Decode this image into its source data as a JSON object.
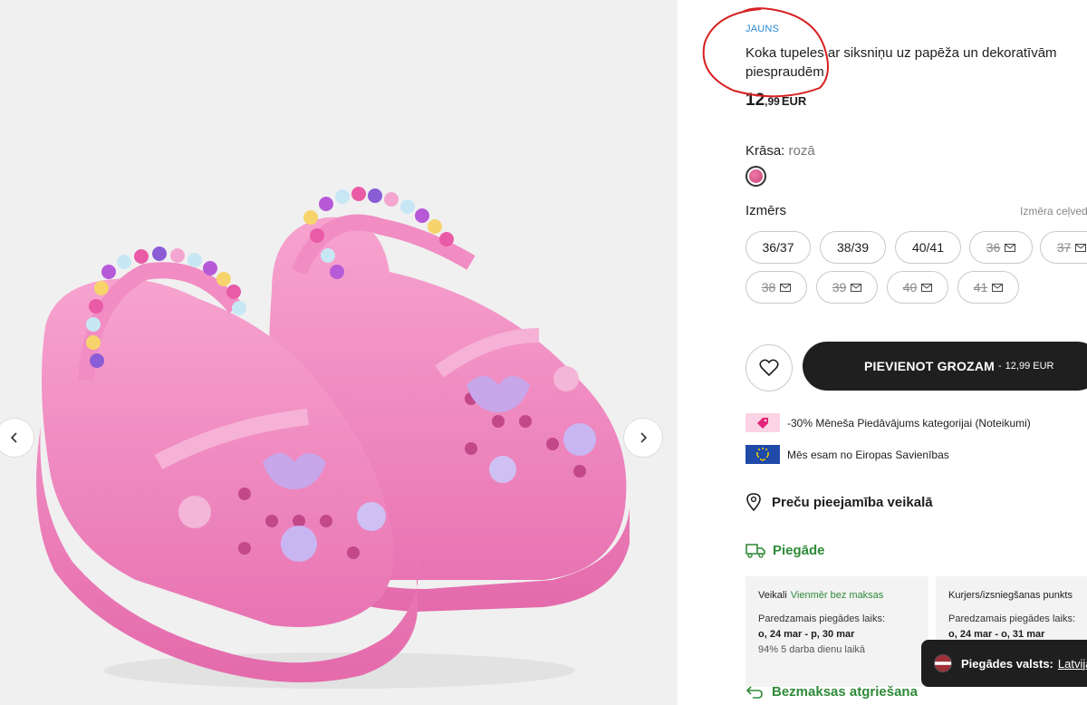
{
  "gallery": {
    "image_alt": "Pink clogs with beaded strap and decorative charms",
    "prev_icon": "chevron-left-icon",
    "next_icon": "chevron-right-icon"
  },
  "product": {
    "badge": "JAUNS",
    "title": "Koka tupeles ar siksniņu uz papēža un dekoratīvām piespraudēm",
    "price_int": "12",
    "price_dec": ",99",
    "price_currency": "EUR",
    "color_label": "Krāsa:",
    "color_value": "rozā",
    "swatch_color": "#e0609a",
    "size_label": "Izmērs",
    "size_guide": "Izmēra ceļvedis",
    "sizes": [
      {
        "label": "36/37",
        "available": true
      },
      {
        "label": "38/39",
        "available": true
      },
      {
        "label": "40/41",
        "available": true
      },
      {
        "label": "36",
        "available": false
      },
      {
        "label": "37",
        "available": false
      },
      {
        "label": "38",
        "available": false
      },
      {
        "label": "39",
        "available": false
      },
      {
        "label": "40",
        "available": false
      },
      {
        "label": "41",
        "available": false
      }
    ],
    "add_to_cart": "PIEVIENOT GROZAM",
    "add_to_cart_sep": "-",
    "add_to_cart_price": "12,99 EUR",
    "promo_text": "-30% Mēneša Piedāvājums kategorijai (Noteikumi)",
    "eu_text": "Mēs esam no Eiropas Savienības",
    "availability": "Preču pieejamība veikalā",
    "delivery_title": "Piegāde",
    "delivery_options": [
      {
        "name": "Veikali",
        "badge": "Vienmēr bez maksas",
        "estimate_label": "Paredzamais piegādes laiks:",
        "dates": "o, 24 mar - p, 30 mar",
        "note": "94% 5 darba dienu laikā"
      },
      {
        "name": "Kurjers/izsniegšanas punkts",
        "badge": "",
        "estimate_label": "Paredzamais piegādes laiks:",
        "dates": "o, 24 mar - o, 31 mar",
        "note": ""
      }
    ],
    "returns": "Bezmaksas atgriešana"
  },
  "country_bar": {
    "label": "Piegādes valsts:",
    "value": "Latvija"
  },
  "colors": {
    "badge_blue": "#2b8ad4",
    "green": "#2e8a37",
    "dark_button": "#1f1f1f",
    "annotation_red": "#d62020"
  }
}
